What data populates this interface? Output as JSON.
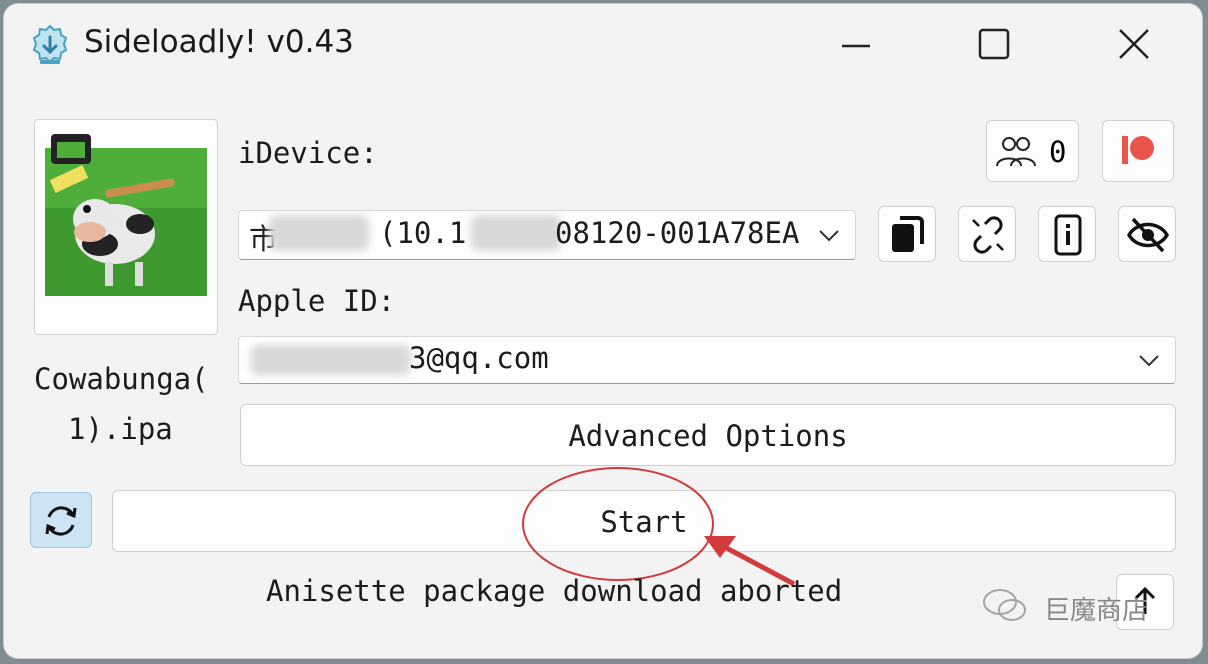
{
  "window": {
    "title": "Sideloadly! v0.43",
    "controls": [
      "minimize-icon",
      "maximize-icon",
      "close-icon"
    ]
  },
  "ipa": {
    "filename_line1": "Cowabunga(",
    "filename_line2": "1).ipa"
  },
  "device": {
    "label": "iDevice:",
    "selected_prefix": "市",
    "selected_mid": "(10.1",
    "selected_suffix": "08120-001A78EA",
    "users_count": "0",
    "action_icons": [
      "copy-icon",
      "unlink-icon",
      "device-info-icon",
      "hide-eye-icon"
    ]
  },
  "account": {
    "label": "Apple ID:",
    "value_suffix": "3@qq.com"
  },
  "buttons": {
    "advanced_options": "Advanced Options",
    "start": "Start"
  },
  "status": {
    "text": "Anisette package download aborted"
  },
  "watermark": {
    "text": "巨魔商店"
  },
  "colors": {
    "window_bg": "#f3f3f3",
    "accent_icon": "#4aa3c7",
    "patreon": "#e8554a",
    "refresh_bg": "#cde4f5",
    "annotation_red": "#d23b3b"
  }
}
